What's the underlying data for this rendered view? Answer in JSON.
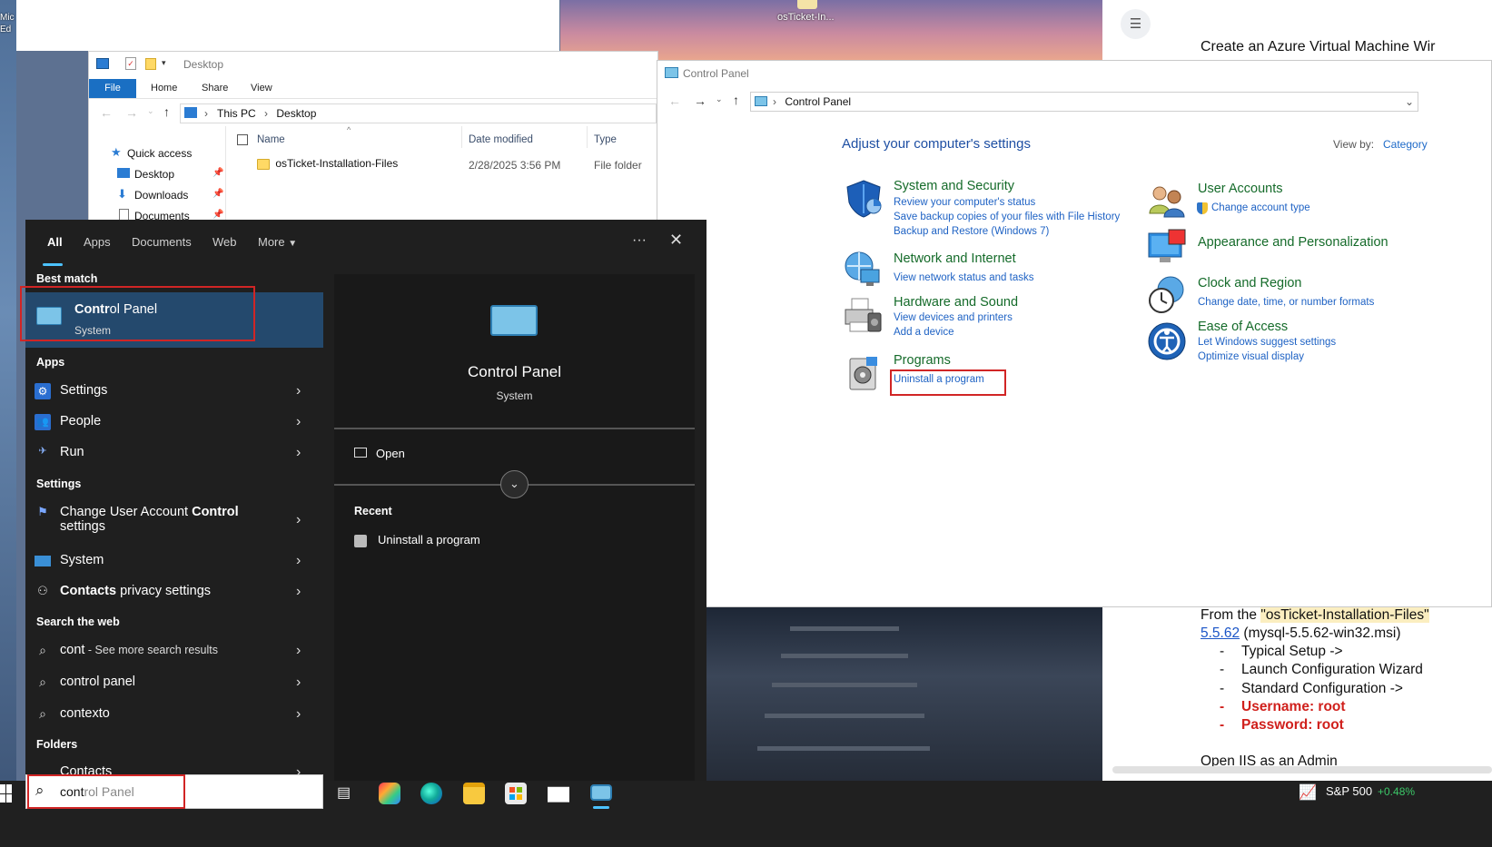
{
  "desktop": {
    "icon_label": "osTicket-In...",
    "left_icon_label": "Mic\nEd"
  },
  "doc": {
    "title": "Create an Azure Virtual Machine Wir",
    "lines": {
      "l1_prefix": "From the ",
      "l1_highlight": "\"osTicket-Installation-Files\"",
      "l2_link": "5.5.62",
      "l2_rest": " (mysql-5.5.62-win32.msi)",
      "b1": "Typical Setup ->",
      "b2": "Launch Configuration Wizard",
      "b3": "Standard Configuration ->",
      "b4": "Username: root",
      "b5": "Password: root",
      "l3": "Open IIS as an Admin"
    },
    "bullet": "-"
  },
  "explorer": {
    "title": "Desktop",
    "ribbon_tabs": [
      "File",
      "Home",
      "Share",
      "View"
    ],
    "breadcrumb": [
      "This PC",
      "Desktop"
    ],
    "nav": [
      "Quick access",
      "Desktop",
      "Downloads",
      "Documents"
    ],
    "columns": [
      "Name",
      "Date modified",
      "Type"
    ],
    "files": [
      {
        "name": "osTicket-Installation-Files",
        "date": "2/28/2025 3:56 PM",
        "type": "File folder"
      }
    ]
  },
  "control_panel": {
    "title": "Control Panel",
    "breadcrumb": "Control Panel",
    "heading": "Adjust your computer's settings",
    "view_by_label": "View by:",
    "view_by_value": "Category",
    "categories_left": [
      {
        "name": "System and Security",
        "links": [
          "Review your computer's status",
          "Save backup copies of your files with File History",
          "Backup and Restore (Windows 7)"
        ],
        "icon": "shield-icon"
      },
      {
        "name": "Network and Internet",
        "links": [
          "View network status and tasks"
        ],
        "icon": "network-icon"
      },
      {
        "name": "Hardware and Sound",
        "links": [
          "View devices and printers",
          "Add a device"
        ],
        "icon": "printer-icon"
      },
      {
        "name": "Programs",
        "links": [
          "Uninstall a program"
        ],
        "icon": "programs-icon"
      }
    ],
    "categories_right": [
      {
        "name": "User Accounts",
        "links": [
          "Change account type"
        ],
        "icon": "users-icon"
      },
      {
        "name": "Appearance and Personalization",
        "links": [],
        "icon": "monitor-icon"
      },
      {
        "name": "Clock and Region",
        "links": [
          "Change date, time, or number formats"
        ],
        "icon": "clock-icon"
      },
      {
        "name": "Ease of Access",
        "links": [
          "Let Windows suggest settings",
          "Optimize visual display"
        ],
        "icon": "accessibility-icon"
      }
    ]
  },
  "start_menu": {
    "tabs": [
      "All",
      "Apps",
      "Documents",
      "Web",
      "More"
    ],
    "more_icon": "ellipsis-icon",
    "best_match_header": "Best match",
    "best_match": {
      "name_bold": "Contr",
      "name_rest": "ol Panel",
      "sub": "System"
    },
    "apps_header": "Apps",
    "apps": [
      "Settings",
      "People",
      "Run"
    ],
    "settings_header": "Settings",
    "settings": [
      {
        "pre": "Change User Account ",
        "bold": "Control",
        "post": "",
        "line2": "settings"
      },
      {
        "pre": "System",
        "bold": "",
        "post": "",
        "line2": ""
      },
      {
        "pre": "",
        "bold": "Contacts",
        "post": " privacy settings",
        "line2": ""
      }
    ],
    "web_header": "Search the web",
    "web": [
      {
        "bold": "cont",
        "rest": " - See more search results"
      },
      {
        "bold": "control panel",
        "rest": ""
      },
      {
        "bold": "contexto",
        "rest": ""
      }
    ],
    "folders_header": "Folders",
    "folders": [
      "Contacts"
    ],
    "preview": {
      "title": "Control Panel",
      "sub": "System",
      "open_label": "Open",
      "recent_header": "Recent",
      "recent": [
        "Uninstall a program"
      ]
    }
  },
  "taskbar": {
    "search_typed": "cont",
    "search_suggest": "rol Panel",
    "ticker_name": "S&P 500",
    "ticker_change": "+0.48%",
    "ticker_color": "#3cc768"
  },
  "colors": {
    "accent": "#4cc2ff",
    "highlight_box": "#d12525",
    "cp_green": "#156b2a",
    "cp_link": "#1e62c4"
  }
}
